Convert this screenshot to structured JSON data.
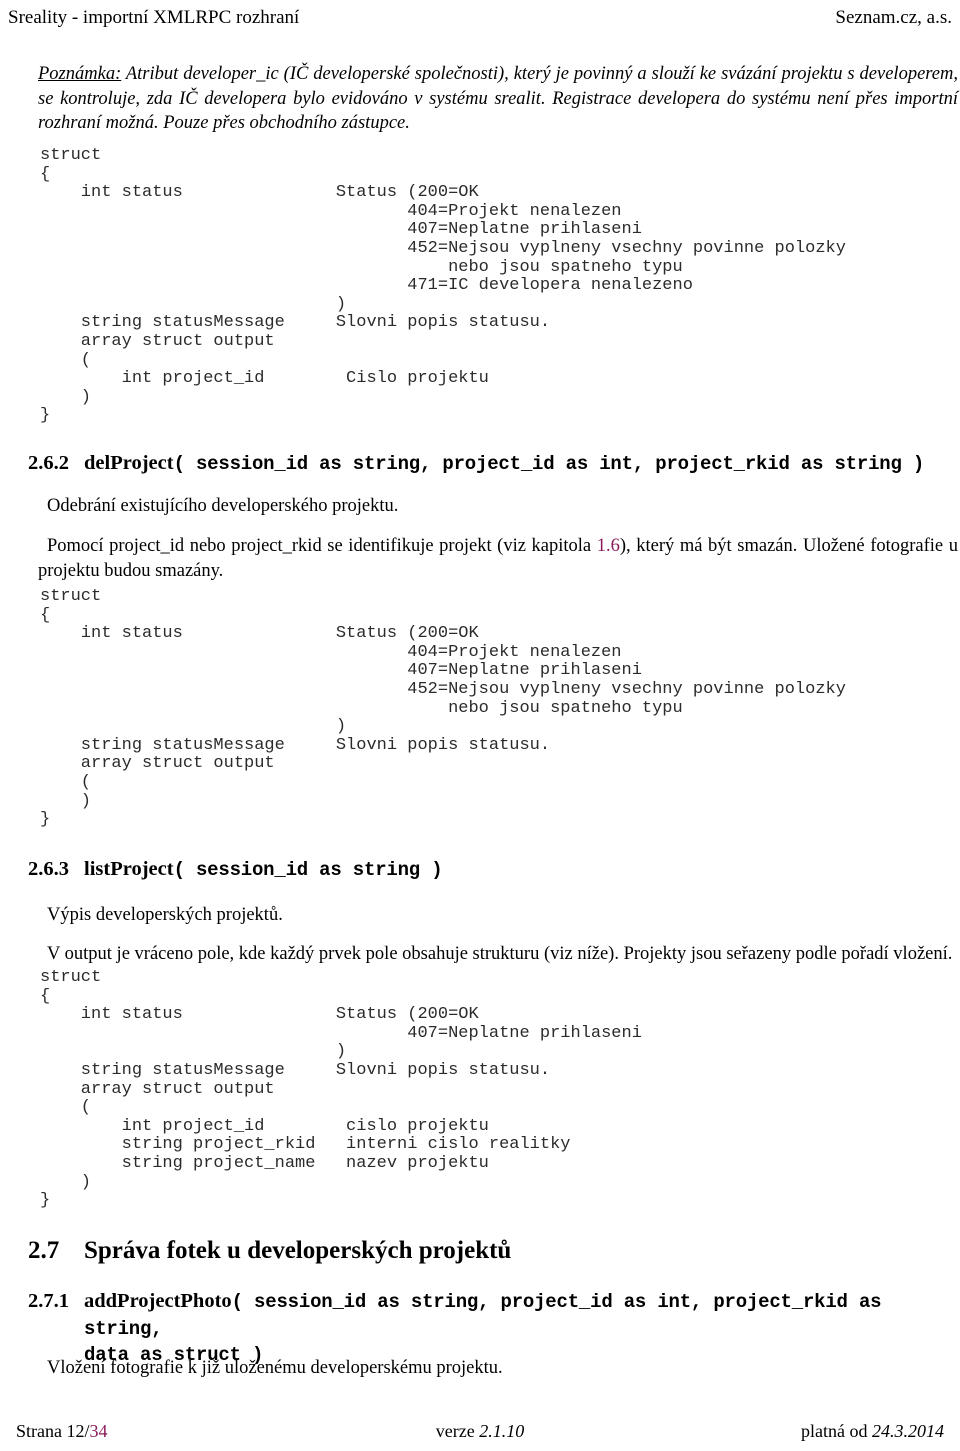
{
  "running_head": {
    "left": "Sreality - importní XMLRPC rozhraní",
    "right": "Seznam.cz, a.s."
  },
  "note": {
    "lead": "Poznámka:",
    "text": " Atribut developer_ic (IČ developerské společnosti), který je povinný a slouží ke svázání projektu s developerem, se kontroluje, zda IČ developera bylo evidováno v systému srealit. Registrace developera do systému není přes importní rozhraní možná. Pouze přes obchodního zástupce."
  },
  "code_blocks": {
    "addproject_response": "struct\n{\n    int status               Status (200=OK\n                                    404=Projekt nenalezen\n                                    407=Neplatne prihlaseni\n                                    452=Nejsou vyplneny vsechny povinne polozky\n                                        nebo jsou spatneho typu\n                                    471=IC developera nenalezeno\n                             )\n    string statusMessage     Slovni popis statusu.\n    array struct output\n    (\n        int project_id        Cislo projektu\n    )\n}",
    "delproject_response": "struct\n{\n    int status               Status (200=OK\n                                    404=Projekt nenalezen\n                                    407=Neplatne prihlaseni\n                                    452=Nejsou vyplneny vsechny povinne polozky\n                                        nebo jsou spatneho typu\n                             )\n    string statusMessage     Slovni popis statusu.\n    array struct output\n    (\n    )\n}",
    "listproject_response": "struct\n{\n    int status               Status (200=OK\n                                    407=Neplatne prihlaseni\n                             )\n    string statusMessage     Slovni popis statusu.\n    array struct output\n    (\n        int project_id        cislo projektu\n        string project_rkid   interni cislo realitky\n        string project_name   nazev projektu\n    )\n}"
  },
  "sections": {
    "delproject": {
      "number": "2.6.2",
      "name": "delProject",
      "signature": "( session_id as string, project_id as int, project_rkid as string )",
      "para1": "Odebrání existujícího developerského projektu.",
      "para2_before": "Pomocí project_id nebo project_rkid se identifikuje projekt (viz kapitola ",
      "para2_link": "1.6",
      "para2_after": "), který má být smazán. Uložené fotografie u projektu budou smazány."
    },
    "listproject": {
      "number": "2.6.3",
      "name": "listProject",
      "signature": "( session_id as string )",
      "para1": "Výpis developerských projektů.",
      "para2": "V output je vráceno pole, kde každý prvek pole obsahuje strukturu (viz níže). Projekty jsou seřazeny podle pořadí vložení."
    },
    "photos": {
      "number": "2.7",
      "title": "Správa fotek u developerských projektů"
    },
    "addprojectphoto": {
      "number": "2.7.1",
      "name": "addProjectPhoto",
      "signature_line1": "( session_id as string, project_id as int, project_rkid as string,",
      "signature_line2": "data as struct )",
      "para1": "Vložení fotografie k již uloženému developerskému projektu."
    }
  },
  "footer": {
    "page_label": "Strana ",
    "page_current": "12",
    "page_sep": "/",
    "page_total": "34",
    "version_label": "verze ",
    "version_value": "2.1.10",
    "valid_label": "platná od ",
    "valid_value": "24.3.2014"
  },
  "colors": {
    "link": "#8b1a5a",
    "code_text": "#2b2b2b",
    "body_text": "#000000"
  }
}
